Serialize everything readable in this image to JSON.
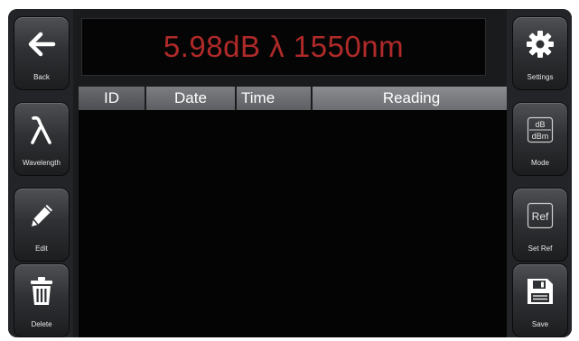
{
  "display": {
    "reading": "5.98dB λ 1550nm",
    "color": "#b02a2a"
  },
  "left_buttons": [
    {
      "icon": "back-arrow-icon",
      "label": "Back"
    },
    {
      "icon": "lambda-icon",
      "label": "Wavelength"
    },
    {
      "icon": "pencil-icon",
      "label": "Edit"
    },
    {
      "icon": "trash-icon",
      "label": "Delete"
    }
  ],
  "right_buttons": [
    {
      "icon": "gear-icon",
      "label": "Settings"
    },
    {
      "icon": "db-dbm-icon",
      "label": "Mode",
      "icon_top": "dB",
      "icon_bottom": "dBm"
    },
    {
      "icon": "ref-icon",
      "label": "Set Ref",
      "icon_text": "Ref"
    },
    {
      "icon": "floppy-disk-icon",
      "label": "Save"
    }
  ],
  "table": {
    "columns": [
      "ID",
      "Date",
      "Time",
      "Reading"
    ],
    "rows": []
  }
}
